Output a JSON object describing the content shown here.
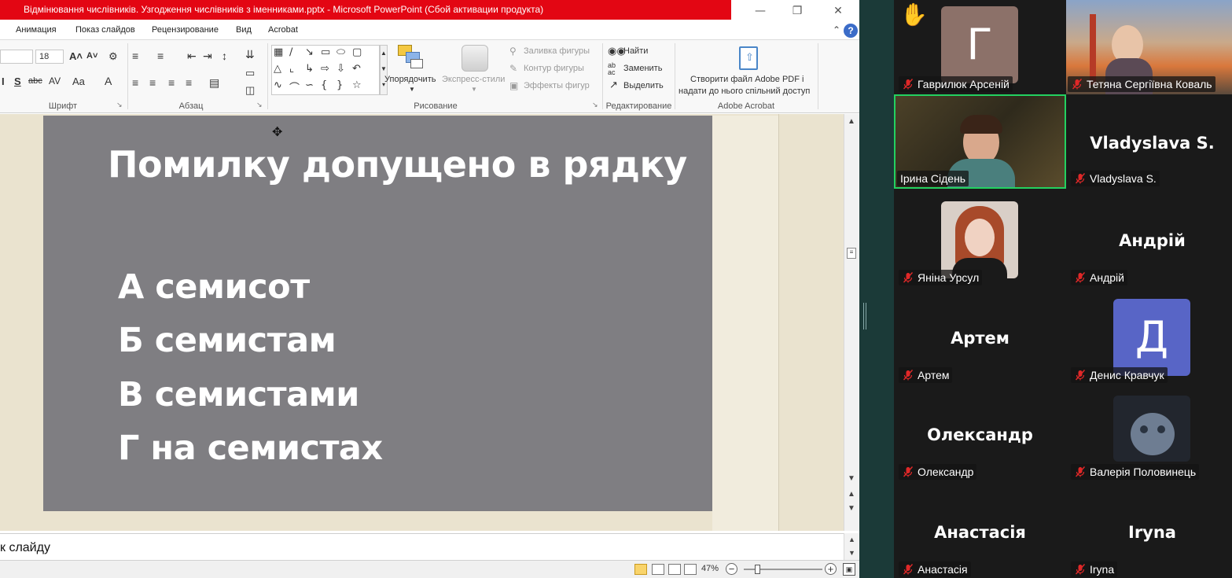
{
  "window": {
    "title": "Відмінювання числівників. Узгодження числівників з іменниками.pptx - Microsoft PowerPoint (Сбой активации продукта)"
  },
  "menu": {
    "tabs": [
      "Анимация",
      "Показ слайдов",
      "Рецензирование",
      "Вид",
      "Acrobat"
    ],
    "help": "?"
  },
  "ribbon": {
    "font_group": "Шрифт",
    "font_size": "18",
    "paragraph_group": "Абзац",
    "drawing_group": "Рисование",
    "arrange_label": "Упорядочить",
    "quick_styles_label": "Экспресс-стили",
    "shape_fill": "Заливка фигуры",
    "shape_outline": "Контур фигуры",
    "shape_effects": "Эффекты фигур",
    "editing_group": "Редактирование",
    "find_label": "Найти",
    "replace_label": "Заменить",
    "select_label": "Выделить",
    "acrobat_group": "Adobe Acrobat",
    "acrobat_line1": "Створити файл Adobe PDF і",
    "acrobat_line2": "надати до нього спільний доступ"
  },
  "slide": {
    "heading": "Помилку допущено в рядку",
    "options": [
      "А семисот",
      "Б семистам",
      "В семистами",
      "Г на семистах"
    ],
    "background_color": "#7f7e82"
  },
  "notes": {
    "text": "к слайду"
  },
  "statusbar": {
    "zoom": "47%"
  },
  "participants": [
    {
      "name": "Гаврилюк Арсеній",
      "display": "avatar",
      "initial": "Г",
      "avatar_color": "#8c7169",
      "muted": true,
      "hand_raised": true
    },
    {
      "name": "Тетяна Сергіївна Коваль",
      "display": "video",
      "muted": true
    },
    {
      "name": "Ірина Сідень",
      "display": "video",
      "muted": false,
      "active_speaker": true
    },
    {
      "name": "Vladyslava S.",
      "display": "name",
      "muted": true
    },
    {
      "name": "Яніна Урсул",
      "display": "photo",
      "muted": true
    },
    {
      "name": "Андрій",
      "display": "name",
      "muted": true
    },
    {
      "name": "Артем",
      "display": "name",
      "muted": true
    },
    {
      "name": "Денис Кравчук",
      "display": "avatar",
      "initial": "Д",
      "avatar_color": "#5865c6",
      "muted": true
    },
    {
      "name": "Олександр",
      "display": "name",
      "muted": true
    },
    {
      "name": "Валерія Половинець",
      "display": "photo",
      "muted": true
    },
    {
      "name": "Анастасія",
      "display": "name",
      "muted": true
    },
    {
      "name": "Iryna",
      "display": "name",
      "muted": true
    }
  ],
  "colors": {
    "title_bar": "#e30613",
    "active_speaker_border": "#23d160",
    "muted_mic": "#e02828"
  }
}
